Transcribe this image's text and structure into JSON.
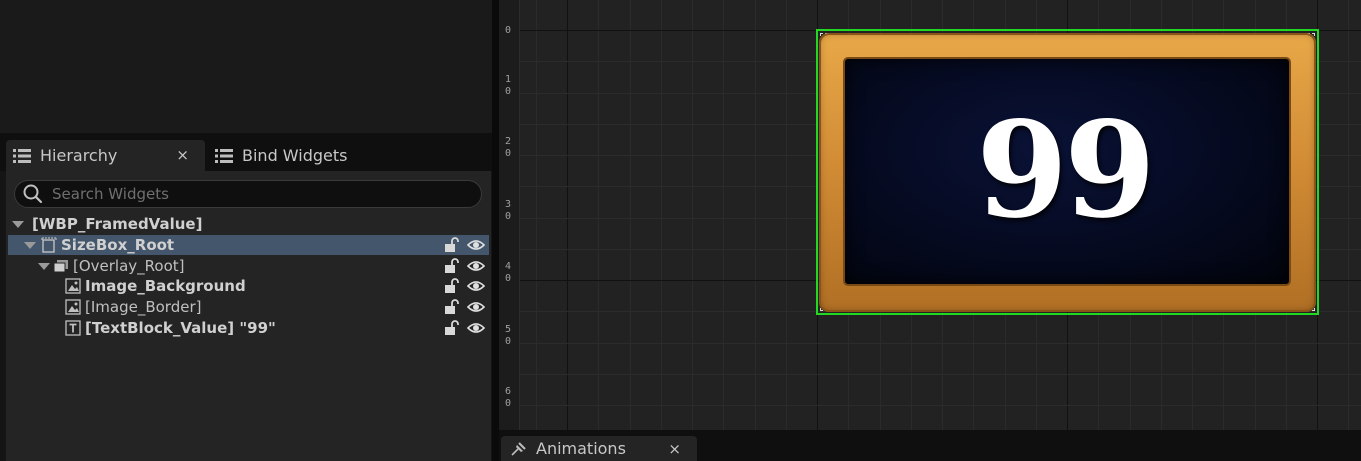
{
  "hierarchy_panel": {
    "tabs": [
      {
        "label": "Hierarchy",
        "close": "×"
      },
      {
        "label": "Bind Widgets"
      }
    ],
    "search": {
      "placeholder": "Search Widgets",
      "value": ""
    },
    "tree": [
      {
        "label": "[WBP_FramedValue]",
        "icon": "none",
        "expanded": true,
        "selected": false
      },
      {
        "label": "SizeBox_Root",
        "icon": "size-box-icon",
        "expanded": true,
        "selected": true
      },
      {
        "label": "[Overlay_Root]",
        "icon": "overlay-icon",
        "expanded": true,
        "selected": false
      },
      {
        "label": "Image_Background",
        "icon": "image-icon",
        "selected": false
      },
      {
        "label": "[Image_Border]",
        "icon": "image-icon",
        "selected": false
      },
      {
        "label": "[TextBlock_Value] \"99\"",
        "icon": "text-block-icon",
        "selected": false
      }
    ]
  },
  "designer": {
    "ruler_labels": [
      "0",
      "1\n0",
      "2\n0",
      "3\n0",
      "4\n0",
      "5\n0",
      "6\n0"
    ],
    "widget_value_text": "99",
    "selection_color": "#22d822",
    "frame_color": "#d08a34",
    "inner_color": "#050a20"
  },
  "bottom_tab": {
    "label": "Animations",
    "close": "×"
  }
}
